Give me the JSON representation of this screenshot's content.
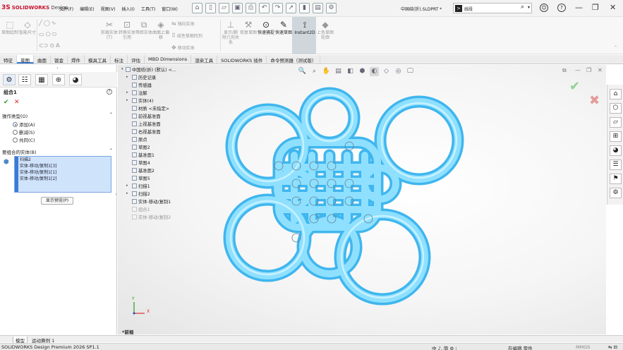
{
  "titlebar": {
    "logo_ds": "3S",
    "logo_brand": "SOLIDWORKS",
    "logo_rest": " Design",
    "menu": [
      "文件(F)",
      "编辑(E)",
      "视图(V)",
      "插入(I)",
      "工具(T)",
      "窗口(W)"
    ],
    "filename": "中国结(折).SLDPRT *",
    "search_badge": ">",
    "search_text": "线段",
    "win_min": "—",
    "win_max": "❐",
    "win_close": "✕"
  },
  "ribbon": {
    "big": [
      {
        "label": "草图绘制",
        "glyph": "⬚"
      },
      {
        "label": "智能尺寸",
        "glyph": "◇"
      },
      {
        "label": "剪裁实体(T)",
        "glyph": "✂"
      },
      {
        "label": "转换实体引用",
        "glyph": "⊡"
      },
      {
        "label": "等距实体",
        "glyph": "⧉"
      },
      {
        "label": "曲面上偏移",
        "glyph": "◈"
      },
      {
        "label": "显示/删除几何关系",
        "glyph": "⊥"
      },
      {
        "label": "修复草图",
        "glyph": "⚒"
      },
      {
        "label": "快速捕捉",
        "glyph": "⊙"
      },
      {
        "label": "快速草图",
        "glyph": "✎"
      },
      {
        "label": "Instant2D",
        "glyph": "⟟"
      },
      {
        "label": "上色草图轮廓",
        "glyph": "◆"
      }
    ],
    "small": [
      {
        "label": "镜向实体",
        "glyph": "⇋"
      },
      {
        "label": "线性草图阵列",
        "glyph": "⠿"
      },
      {
        "label": "移动实体",
        "glyph": "✥"
      }
    ]
  },
  "tabs": [
    "特征",
    "草图",
    "曲面",
    "钣金",
    "焊件",
    "模具工具",
    "标注",
    "评估",
    "MBD Dimensions",
    "渲染工具",
    "SOLIDWORKS 插件",
    "命令预测器（测试版）"
  ],
  "property_manager": {
    "title": "组合1",
    "help": "?",
    "ok": "✔",
    "cancel": "✕",
    "op_section": "操作类型(O)",
    "op_options": [
      "添加(A)",
      "删减(S)",
      "共同(C)"
    ],
    "bodies_section": "要组合的实体(B)",
    "bodies": [
      "扫描2",
      "实体-移动/复制1[3]",
      "实体-移动/复制1[1]",
      "实体-移动/复制1[2]"
    ],
    "preview_button": "显示预览(P)"
  },
  "tree": {
    "root": "中国结(折)  (默认) <...",
    "items": [
      "历史记录",
      "传感器",
      "注解",
      "实体(4)",
      "材质 <未指定>",
      "前视基准面",
      "上视基准面",
      "右视基准面",
      "原点",
      "草图2",
      "基准面1",
      "草图4",
      "基准面2",
      "草图5",
      "扫描1",
      "扫描2",
      "实体-移动/复制1",
      "组合1",
      "实体-移动/复制2"
    ]
  },
  "viewport": {
    "tools": [
      "🔍",
      "⌕",
      "✋",
      "▤",
      "◧",
      "⬢",
      "◐",
      "◇",
      "◎",
      "🖵"
    ],
    "confirm_ok": "✔",
    "confirm_x": "✖",
    "triad_x": "X",
    "triad_y": "Y",
    "bottom_label": "*前视"
  },
  "taskpane": [
    "⌂",
    "⬡",
    "▱",
    "⊞",
    "◕",
    "☰",
    "⚑",
    "⚙"
  ],
  "bottom_tabs": [
    "模型",
    "运动算例 1"
  ],
  "status": {
    "left": "SOLIDWORKS Design Premium 2026 SP1.1",
    "ime": "中 ♪, 简 ⚙ ⁝",
    "mode": "在编辑 零件",
    "units": "MMGS",
    "tail": "⇆ ⊟"
  },
  "colors": {
    "accent": "#3a7bd5",
    "knot": "#7fd8ff",
    "brand": "#c8102e"
  }
}
